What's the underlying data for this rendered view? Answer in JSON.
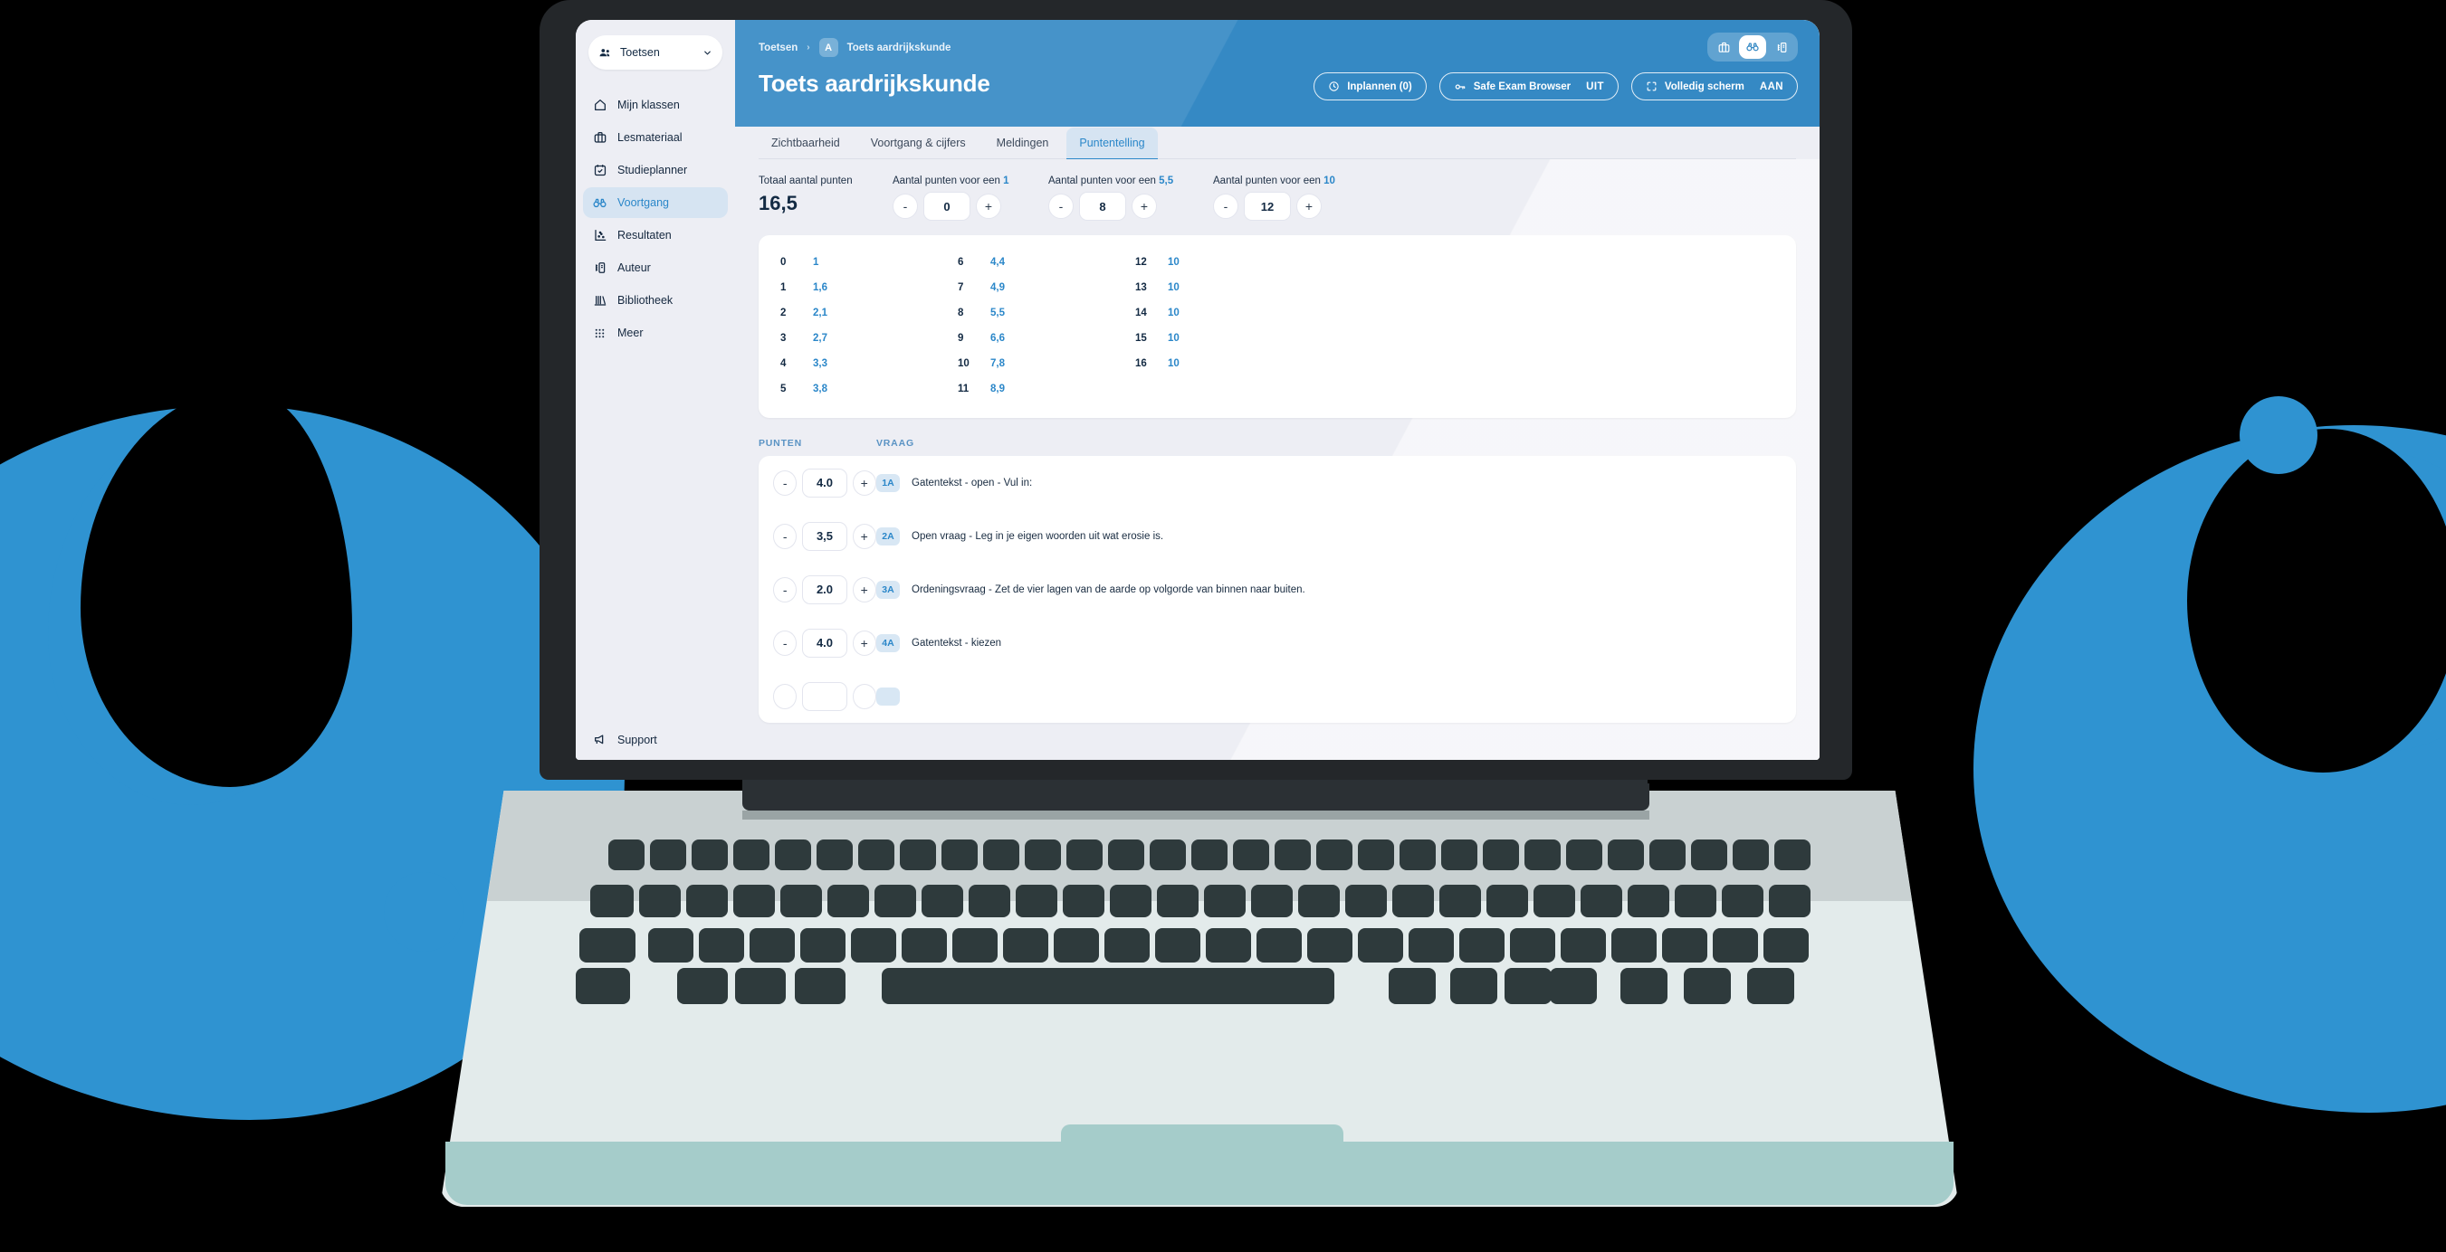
{
  "sidebar": {
    "workspace": {
      "label": "Toetsen",
      "icon": "users-icon",
      "chevron": "chevron-down-icon"
    },
    "items": [
      {
        "label": "Mijn klassen",
        "icon": "home-icon",
        "active": false
      },
      {
        "label": "Lesmateriaal",
        "icon": "briefcase-icon",
        "active": false
      },
      {
        "label": "Studieplanner",
        "icon": "calendar-check-icon",
        "active": false
      },
      {
        "label": "Voortgang",
        "icon": "binoculars-icon",
        "active": true
      },
      {
        "label": "Resultaten",
        "icon": "scatter-chart-icon",
        "active": false
      },
      {
        "label": "Auteur",
        "icon": "author-icon",
        "active": false
      },
      {
        "label": "Bibliotheek",
        "icon": "books-icon",
        "active": false
      },
      {
        "label": "Meer",
        "icon": "grid-dots-icon",
        "active": false
      }
    ],
    "support": {
      "label": "Support",
      "icon": "megaphone-icon"
    }
  },
  "header": {
    "breadcrumb": {
      "root": "Toetsen",
      "separator": "›",
      "avatar": "A",
      "current": "Toets aardrijkskunde"
    },
    "title": "Toets aardrijkskunde",
    "view_toggles": [
      {
        "icon": "briefcase-icon",
        "active": false
      },
      {
        "icon": "binoculars-icon",
        "active": true
      },
      {
        "icon": "author-icon",
        "active": false
      }
    ],
    "actions": [
      {
        "icon": "clock-icon",
        "label": "Inplannen (0)",
        "state": ""
      },
      {
        "icon": "key-icon",
        "label": "Safe Exam Browser",
        "state": "UIT"
      },
      {
        "icon": "fullscreen-icon",
        "label": "Volledig scherm",
        "state": "AAN"
      }
    ]
  },
  "tabs": [
    {
      "label": "Zichtbaarheid",
      "active": false
    },
    {
      "label": "Voortgang & cijfers",
      "active": false
    },
    {
      "label": "Meldingen",
      "active": false
    },
    {
      "label": "Puntentelling",
      "active": true
    }
  ],
  "scoring": {
    "total": {
      "label": "Totaal aantal punten",
      "value": "16,5"
    },
    "thresholds": [
      {
        "label_prefix": "Aantal punten voor een ",
        "grade": "1",
        "value": "0",
        "minus": "-",
        "plus": "+"
      },
      {
        "label_prefix": "Aantal punten voor een ",
        "grade": "5,5",
        "value": "8",
        "minus": "-",
        "plus": "+"
      },
      {
        "label_prefix": "Aantal punten voor een ",
        "grade": "10",
        "value": "12",
        "minus": "-",
        "plus": "+"
      }
    ]
  },
  "grade_table": {
    "columns": [
      [
        {
          "points": "0",
          "grade": "1"
        },
        {
          "points": "1",
          "grade": "1,6"
        },
        {
          "points": "2",
          "grade": "2,1"
        },
        {
          "points": "3",
          "grade": "2,7"
        },
        {
          "points": "4",
          "grade": "3,3"
        },
        {
          "points": "5",
          "grade": "3,8"
        }
      ],
      [
        {
          "points": "6",
          "grade": "4,4"
        },
        {
          "points": "7",
          "grade": "4,9"
        },
        {
          "points": "8",
          "grade": "5,5"
        },
        {
          "points": "9",
          "grade": "6,6"
        },
        {
          "points": "10",
          "grade": "7,8"
        },
        {
          "points": "11",
          "grade": "8,9"
        }
      ],
      [
        {
          "points": "12",
          "grade": "10"
        },
        {
          "points": "13",
          "grade": "10"
        },
        {
          "points": "14",
          "grade": "10"
        },
        {
          "points": "15",
          "grade": "10"
        },
        {
          "points": "16",
          "grade": "10"
        }
      ]
    ]
  },
  "questions": {
    "headers": {
      "points": "PUNTEN",
      "question": "VRAAG"
    },
    "rows": [
      {
        "minus": "-",
        "value": "4.0",
        "plus": "+",
        "badge": "1A",
        "text": "Gatentekst - open - Vul in:"
      },
      {
        "minus": "-",
        "value": "3,5",
        "plus": "+",
        "badge": "2A",
        "text": "Open vraag - Leg in je eigen woorden uit wat erosie is."
      },
      {
        "minus": "-",
        "value": "2.0",
        "plus": "+",
        "badge": "3A",
        "text": "Ordeningsvraag - Zet de vier lagen van de aarde op volgorde van binnen naar buiten."
      },
      {
        "minus": "-",
        "value": "4.0",
        "plus": "+",
        "badge": "4A",
        "text": "Gatentekst - kiezen"
      }
    ]
  },
  "colors": {
    "brand_blue": "#3589c4",
    "accent_blue": "#2b87c9",
    "dark_navy": "#132a43",
    "app_bg": "#edeef4",
    "blob_blue": "#2f93d1",
    "laptop_dark": "#24272a",
    "base_light": "#e3ebeb",
    "base_bottom": "#a5ccca"
  }
}
